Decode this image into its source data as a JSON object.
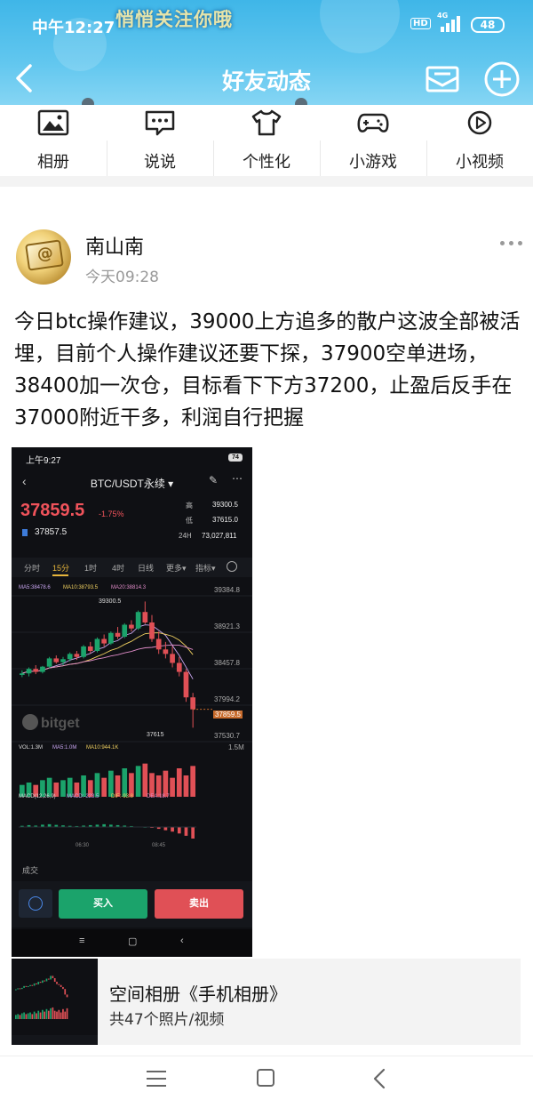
{
  "statusbar": {
    "time": "中午12:27",
    "hd": "HD",
    "network": "4G",
    "battery": "48"
  },
  "header": {
    "banner_text": "悄悄关注你哦",
    "title": "好友动态"
  },
  "quick_menu": [
    {
      "label": "相册",
      "icon": "photo-album-icon"
    },
    {
      "label": "说说",
      "icon": "chat-bubble-icon"
    },
    {
      "label": "个性化",
      "icon": "tshirt-icon"
    },
    {
      "label": "小游戏",
      "icon": "gamepad-icon"
    },
    {
      "label": "小视频",
      "icon": "video-play-icon"
    }
  ],
  "post": {
    "author": "南山南",
    "time": "今天09:28",
    "text": "今日btc操作建议，39000上方追多的散户这波全部被活埋，目前个人操作建议还要下探，37900空单进场，38400加一次仓，目标看下下方37200，止盈后反手在37000附近干多，利润自行把握"
  },
  "screenshot": {
    "status_time": "上午9:27",
    "battery": "74",
    "pair": "BTC/USDT永续 ▾",
    "price": "37859.5",
    "change": "-1.75%",
    "mark_price": "37857.5",
    "high_label": "高",
    "high": "39300.5",
    "low_label": "低",
    "low": "37615.0",
    "vol_label": "24H",
    "vol": "73,027,811",
    "tabs": [
      "分时",
      "15分",
      "1时",
      "4时",
      "日线",
      "更多▾",
      "指标▾"
    ],
    "ma_line": {
      "ma5": "MA5:38478.6",
      "ma10": "MA10:38793.5",
      "ma20": "MA20:38814.3"
    },
    "y_labels": [
      "39384.8",
      "38921.3",
      "38457.8",
      "37994.2",
      "37530.7"
    ],
    "current_label": "37859.5",
    "watermark": "bitget",
    "annot_high": "39300.5",
    "annot_low": "37615",
    "vol_line": {
      "vol": "VOL:1.3M",
      "ma5": "MA5:1.0M",
      "ma10": "MA10:944.1K"
    },
    "vol_max": "1.5M",
    "macd_line": {
      "macd": "MACD(12,26,9)",
      "macd_val": "MACD:-223.5",
      "dif": "DIF:-93.8",
      "dea": "DEA:18.7"
    },
    "time_labels": [
      "06:30",
      "08:45"
    ],
    "trade_label": "成交",
    "buy": "买入",
    "sell": "卖出",
    "candles": [
      [
        38320,
        38380,
        38290,
        38340
      ],
      [
        38340,
        38420,
        38300,
        38400
      ],
      [
        38400,
        38450,
        38330,
        38360
      ],
      [
        38360,
        38440,
        38340,
        38430
      ],
      [
        38430,
        38560,
        38410,
        38540
      ],
      [
        38540,
        38580,
        38470,
        38490
      ],
      [
        38490,
        38560,
        38450,
        38530
      ],
      [
        38530,
        38620,
        38500,
        38600
      ],
      [
        38600,
        38640,
        38520,
        38560
      ],
      [
        38560,
        38720,
        38540,
        38700
      ],
      [
        38700,
        38760,
        38610,
        38640
      ],
      [
        38640,
        38820,
        38620,
        38800
      ],
      [
        38800,
        38860,
        38700,
        38740
      ],
      [
        38740,
        38900,
        38720,
        38880
      ],
      [
        38880,
        38960,
        38800,
        38830
      ],
      [
        38830,
        39010,
        38810,
        38990
      ],
      [
        38990,
        39050,
        38900,
        38940
      ],
      [
        38940,
        39180,
        38920,
        39160
      ],
      [
        39160,
        39300,
        39000,
        39020
      ],
      [
        39020,
        39120,
        38760,
        38800
      ],
      [
        38800,
        38900,
        38600,
        38660
      ],
      [
        38660,
        38760,
        38540,
        38600
      ],
      [
        38600,
        38700,
        38420,
        38480
      ],
      [
        38480,
        38560,
        38300,
        38360
      ],
      [
        38360,
        38400,
        37960,
        38020
      ],
      [
        38020,
        38080,
        37615,
        37860
      ]
    ],
    "volumes": [
      0.5,
      0.6,
      0.5,
      0.7,
      0.8,
      0.6,
      0.7,
      0.8,
      0.6,
      0.9,
      0.7,
      1.0,
      0.8,
      1.1,
      0.9,
      1.2,
      1.0,
      1.3,
      1.4,
      1.0,
      0.9,
      1.1,
      0.8,
      1.2,
      0.9,
      1.3
    ],
    "macd_hist": [
      0.05,
      0.08,
      0.06,
      0.1,
      0.12,
      0.09,
      0.07,
      0.05,
      0.04,
      0.06,
      0.08,
      0.1,
      0.12,
      0.1,
      0.08,
      0.06,
      0.04,
      0.02,
      0.01,
      -0.03,
      -0.08,
      -0.14,
      -0.2,
      -0.28,
      -0.38,
      -0.5
    ]
  },
  "album": {
    "title": "空间相册《手机相册》",
    "sub": "共47个照片/视频"
  },
  "colors": {
    "header_blue": "#3fb6e8",
    "up_green": "#1ba36b",
    "down_red": "#e05056",
    "accent_gold": "#e7b53b"
  }
}
